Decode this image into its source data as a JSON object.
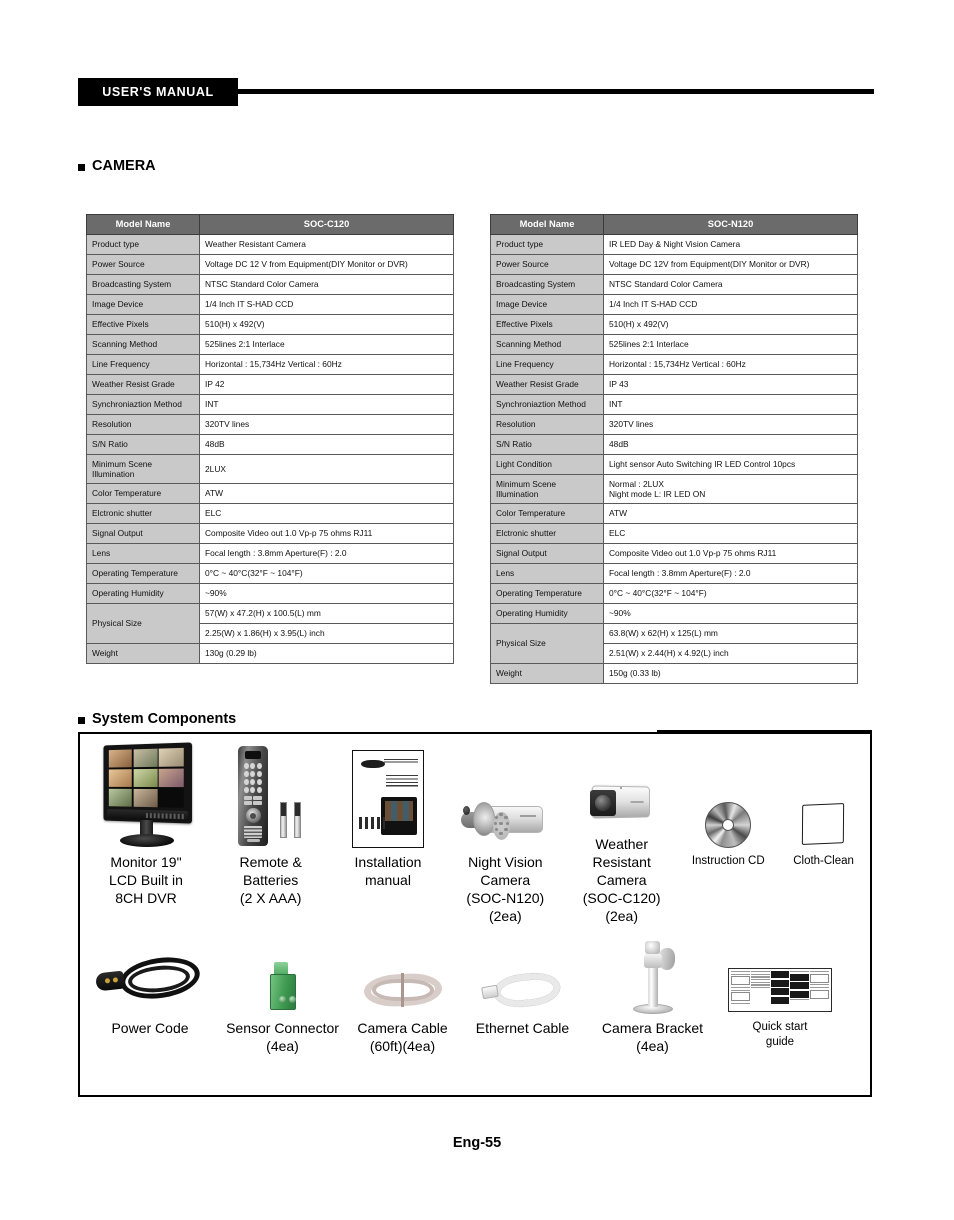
{
  "header": {
    "manual_tag": "USER'S MANUAL"
  },
  "sections": {
    "camera_title": "CAMERA",
    "components_title": "System Components"
  },
  "footer": {
    "page_label": "Eng-55"
  },
  "colors": {
    "table_header_bg": "#6b6b6b",
    "table_header_text": "#ffffff",
    "table_label_bg": "#c9c9c9",
    "table_border": "#5a5a5a",
    "accent_black": "#000000",
    "sensor_connector_green": "#3f9a52"
  },
  "tables": [
    {
      "id": "soc-c120",
      "header": {
        "label_col": "Model Name",
        "value_col": "SOC-C120"
      },
      "rows": [
        {
          "label": "Product type",
          "value": "Weather Resistant Camera"
        },
        {
          "label": "Power Source",
          "value": "Voltage DC 12 V from Equipment(DIY Monitor or DVR)"
        },
        {
          "label": "Broadcasting System",
          "value": "NTSC Standard Color Camera"
        },
        {
          "label": "Image Device",
          "value": "1/4 Inch IT S-HAD CCD"
        },
        {
          "label": "Effective Pixels",
          "value": "510(H) x 492(V)"
        },
        {
          "label": "Scanning Method",
          "value": "525lines 2:1 Interlace"
        },
        {
          "label": "Line Frequency",
          "value": "Horizontal : 15,734Hz Vertical : 60Hz"
        },
        {
          "label": "Weather Resist Grade",
          "value": "IP 42"
        },
        {
          "label": "Synchroniaztion Method",
          "value": "INT"
        },
        {
          "label": "Resolution",
          "value": "320TV lines"
        },
        {
          "label": "S/N Ratio",
          "value": "48dB"
        },
        {
          "label": "Minimum Scene\nIllumination",
          "value": "2LUX",
          "tall": true
        },
        {
          "label": "Color Temperature",
          "value": "ATW"
        },
        {
          "label": "Elctronic shutter",
          "value": "ELC"
        },
        {
          "label": "Signal Output",
          "value": "Composite Video out 1.0 Vp-p 75 ohms RJ11"
        },
        {
          "label": "Lens",
          "value": "Focal length : 3.8mm        Aperture(F) : 2.0"
        },
        {
          "label": "Operating  Temperature",
          "value": "0°C ~ 40°C(32°F ~ 104°F)"
        },
        {
          "label": "Operating    Humidity",
          "value": "~90%"
        },
        {
          "label": "Physical Size",
          "value_lines": [
            "57(W) x 47.2(H) x 100.5(L) mm",
            "2.25(W) x 1.86(H) x 3.95(L) inch"
          ],
          "split": true
        },
        {
          "label": "Weight",
          "value": "130g (0.29 lb)"
        }
      ]
    },
    {
      "id": "soc-n120",
      "header": {
        "label_col": "Model Name",
        "value_col": "SOC-N120"
      },
      "rows": [
        {
          "label": "Product type",
          "value": "IR LED Day & Night Vision Camera"
        },
        {
          "label": "Power Source",
          "value": "Voltage DC 12V from Equipment(DIY Monitor or DVR)"
        },
        {
          "label": "Broadcasting System",
          "value": "NTSC Standard Color Camera"
        },
        {
          "label": "Image Device",
          "value": "1/4 Inch IT S-HAD CCD"
        },
        {
          "label": "Effective Pixels",
          "value": "510(H) x 492(V)"
        },
        {
          "label": "Scanning Method",
          "value": "525lines 2:1 Interlace"
        },
        {
          "label": "Line Frequency",
          "value": "Horizontal : 15,734Hz    Vertical : 60Hz"
        },
        {
          "label": "Weather Resist Grade",
          "value": "IP 43"
        },
        {
          "label": "Synchroniaztion Method",
          "value": "INT"
        },
        {
          "label": "Resolution",
          "value": "320TV lines"
        },
        {
          "label": "S/N Ratio",
          "value": "48dB"
        },
        {
          "label": "Light Condition",
          "value": "Light sensor Auto Switching IR LED Control 10pcs"
        },
        {
          "label": "Minimum Scene\nIllumination",
          "value": "Normal : 2LUX\nNight mode L: IR LED ON",
          "tall": true
        },
        {
          "label": "Color Temperature",
          "value": "ATW"
        },
        {
          "label": "Elctronic shutter",
          "value": "ELC"
        },
        {
          "label": "Signal Output",
          "value": "Composite Video out 1.0 Vp-p 75 ohms RJ11"
        },
        {
          "label": "Lens",
          "value": "Focal length : 3.8mm   Aperture(F) : 2.0"
        },
        {
          "label": "Operating  Temperature",
          "value": "0°C ~ 40°C(32°F ~ 104°F)"
        },
        {
          "label": "Operating    Humidity",
          "value": "~90%"
        },
        {
          "label": "Physical Size",
          "value_lines": [
            "63.8(W) x 62(H) x 125(L) mm",
            "2.51(W) x 2.44(H) x 4.92(L) inch"
          ],
          "split": true
        },
        {
          "label": "Weight",
          "value": "150g (0.33 lb)"
        }
      ]
    }
  ],
  "components": {
    "row1": [
      {
        "icon": "monitor-dvr-icon",
        "label": "Monitor 19\"\nLCD Built in\n8CH DVR"
      },
      {
        "icon": "remote-batteries-icon",
        "label": "Remote &\nBatteries\n(2 X AAA)"
      },
      {
        "icon": "installation-manual-icon",
        "label": "Installation\nmanual"
      },
      {
        "icon": "night-vision-camera-icon",
        "label": "Night Vision\nCamera\n(SOC-N120)\n(2ea)"
      },
      {
        "icon": "weather-resistant-camera-icon",
        "label": "Weather\nResistant\nCamera\n(SOC-C120)\n(2ea)"
      },
      {
        "icon": "instruction-cd-icon",
        "label": "Instruction CD",
        "small": true
      },
      {
        "icon": "cloth-clean-icon",
        "label": "Cloth-Clean",
        "small": true
      }
    ],
    "row2": [
      {
        "icon": "power-cord-icon",
        "label": "Power Code"
      },
      {
        "icon": "sensor-connector-icon",
        "label": "Sensor Connector\n(4ea)"
      },
      {
        "icon": "camera-cable-icon",
        "label": "Camera Cable\n(60ft)(4ea)"
      },
      {
        "icon": "ethernet-cable-icon",
        "label": "Ethernet Cable"
      },
      {
        "icon": "camera-bracket-icon",
        "label": "Camera Bracket\n(4ea)"
      },
      {
        "icon": "quick-start-guide-icon",
        "label": "Quick start\nguide",
        "small": true
      }
    ]
  }
}
